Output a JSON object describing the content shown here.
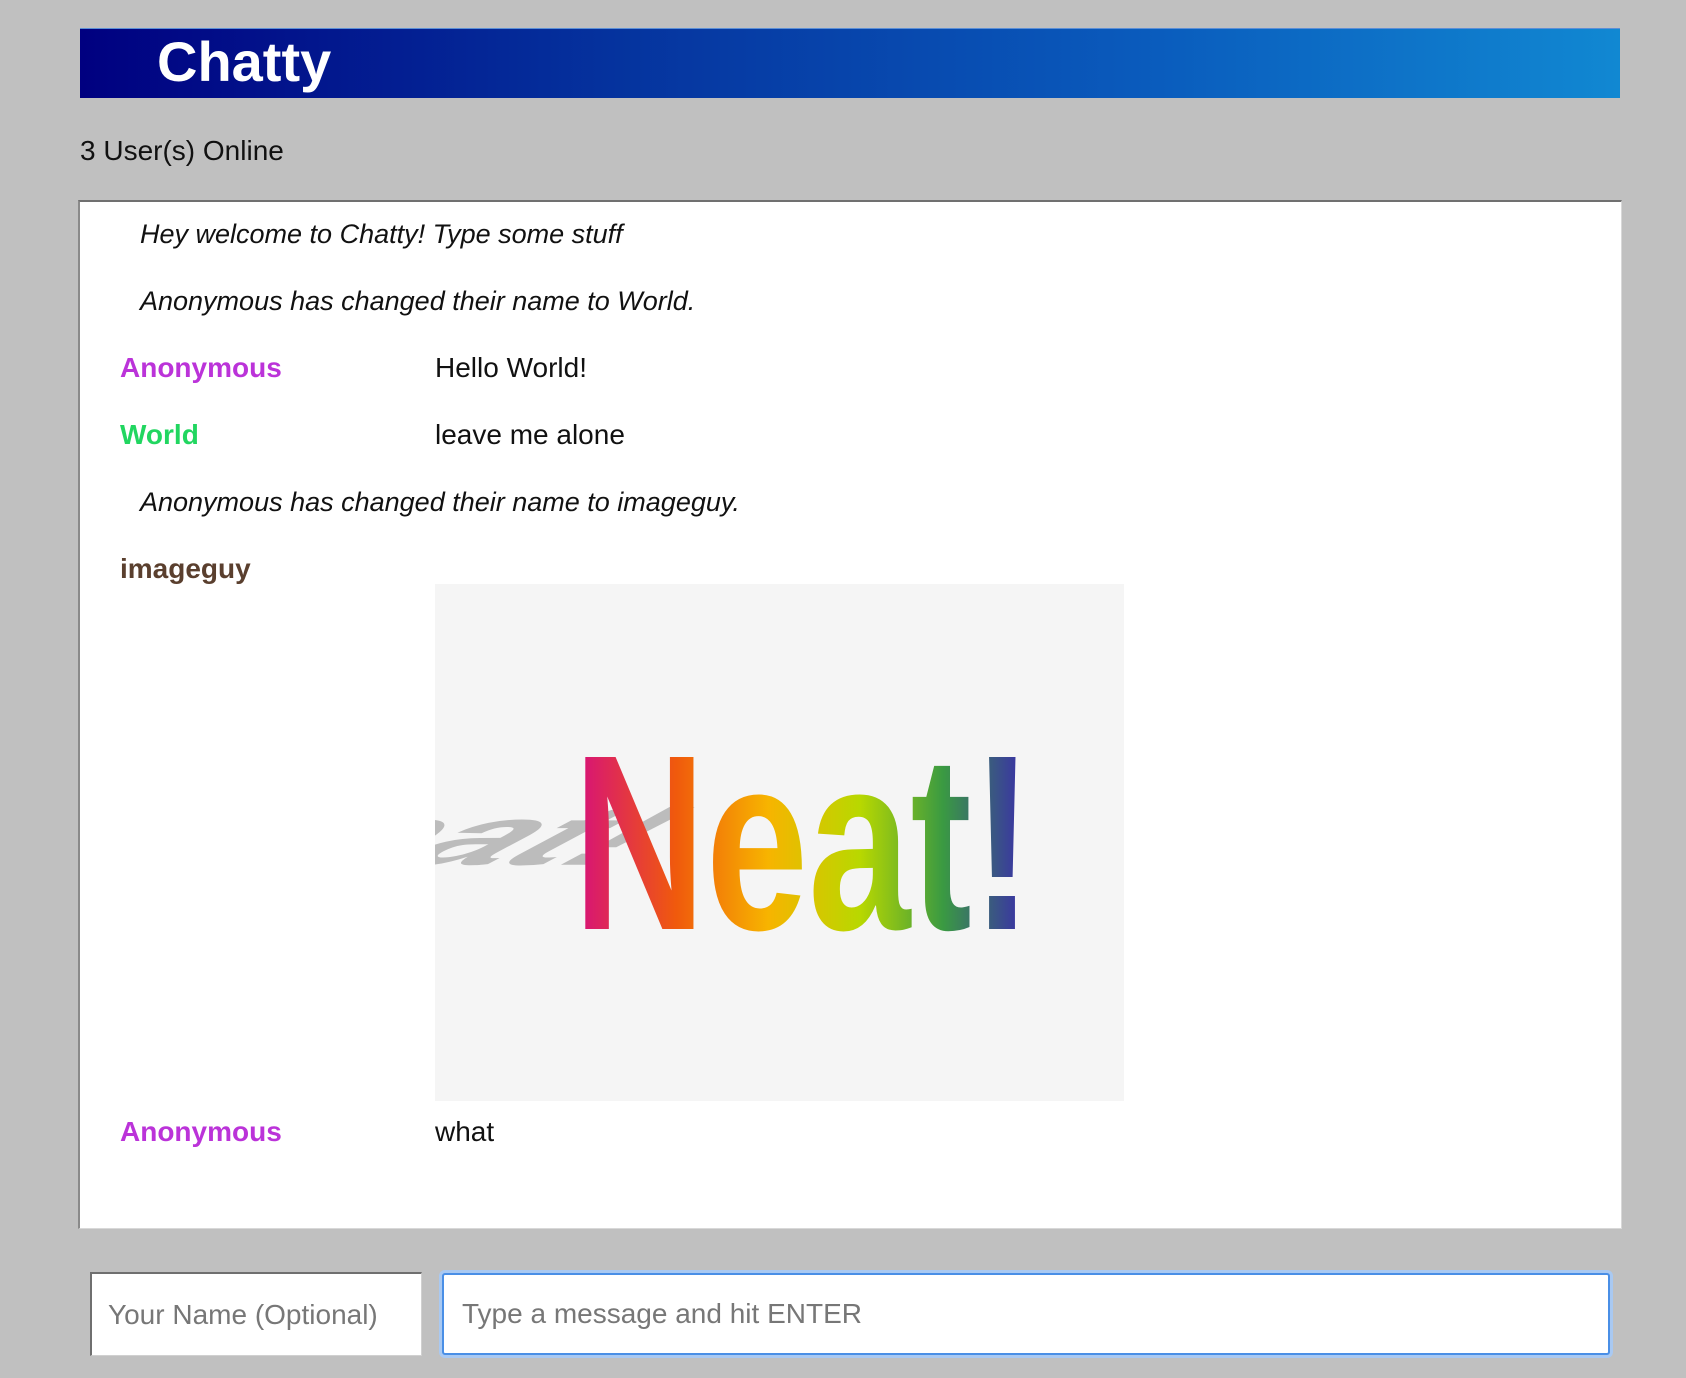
{
  "header": {
    "title": "Chatty"
  },
  "status": {
    "users_online": "3 User(s) Online"
  },
  "messages": [
    {
      "type": "system",
      "text": "Hey welcome to Chatty! Type some stuff"
    },
    {
      "type": "system",
      "text": "Anonymous has changed their name to World."
    },
    {
      "type": "chat",
      "user": "Anonymous",
      "user_color": "#bb33d9",
      "text": "Hello World!"
    },
    {
      "type": "chat",
      "user": "World",
      "user_color": "#21d660",
      "text": "leave me alone"
    },
    {
      "type": "system",
      "text": "Anonymous has changed their name to imageguy."
    },
    {
      "type": "image",
      "user": "imageguy",
      "user_color": "#5a3f2e",
      "image_text": "Neat!"
    },
    {
      "type": "chat",
      "user": "Anonymous",
      "user_color": "#bb33d9",
      "text": "what"
    }
  ],
  "input": {
    "name_placeholder": "Your Name (Optional)",
    "name_value": "",
    "message_placeholder": "Type a message and hit ENTER",
    "message_value": ""
  },
  "colors": {
    "page_bg": "#c0c0c0",
    "header_gradient_start": "#000080",
    "header_gradient_end": "#1188d2",
    "focus_ring": "#4a8fe6"
  }
}
